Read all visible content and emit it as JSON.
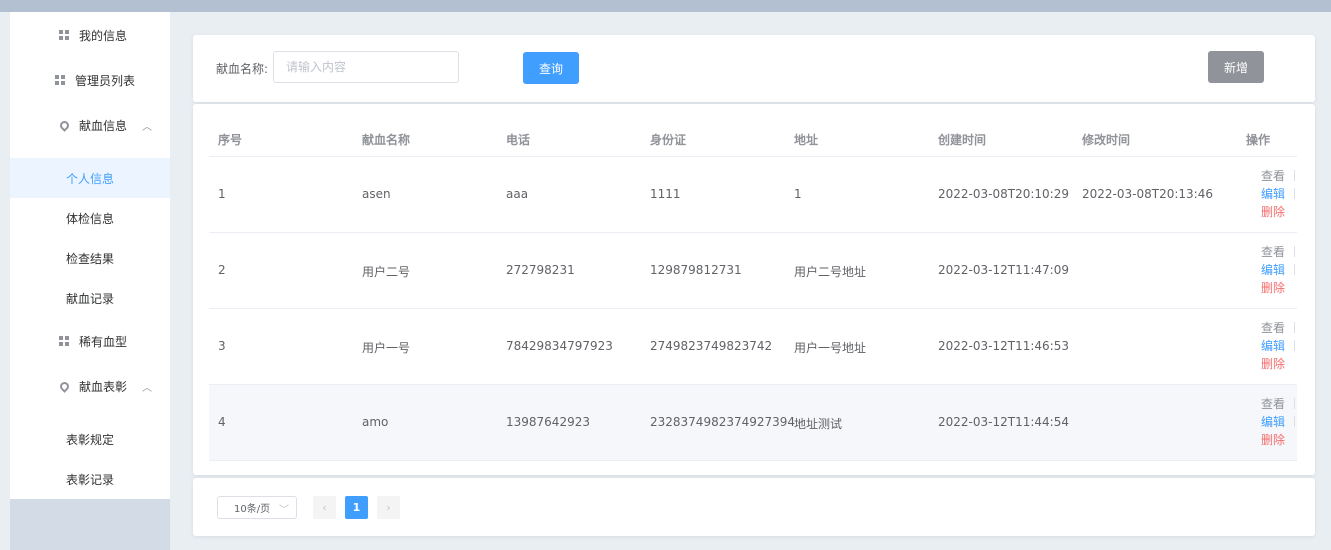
{
  "sidebar": {
    "items": [
      {
        "label": "我的信息",
        "icon": "grid-icon"
      },
      {
        "label": "管理员列表",
        "icon": "grid-icon"
      },
      {
        "label": "献血信息",
        "icon": "location-icon"
      },
      {
        "label": "个人信息"
      },
      {
        "label": "体检信息"
      },
      {
        "label": "检查结果"
      },
      {
        "label": "献血记录"
      },
      {
        "label": "稀有血型",
        "icon": "grid-icon"
      },
      {
        "label": "献血表彰",
        "icon": "location-icon"
      },
      {
        "label": "表彰规定"
      },
      {
        "label": "表彰记录"
      }
    ],
    "active_color": "#409eff"
  },
  "search": {
    "label": "献血名称:",
    "placeholder": "请输入内容",
    "query_label": "查询",
    "add_label": "新增"
  },
  "table": {
    "columns": [
      "序号",
      "献血名称",
      "电话",
      "身份证",
      "地址",
      "创建时间",
      "修改时间",
      "操作"
    ],
    "rows": [
      {
        "idx": "1",
        "name": "asen",
        "phone": "aaa",
        "idcard": "1111",
        "address": "1",
        "created": "2022-03-08T20:10:29",
        "modified": "2022-03-08T20:13:46"
      },
      {
        "idx": "2",
        "name": "用户二号",
        "phone": "272798231",
        "idcard": "129879812731",
        "address": "用户二号地址",
        "created": "2022-03-12T11:47:09",
        "modified": ""
      },
      {
        "idx": "3",
        "name": "用户一号",
        "phone": "78429834797923",
        "idcard": "2749823749823742",
        "address": "用户一号地址",
        "created": "2022-03-12T11:46:53",
        "modified": ""
      },
      {
        "idx": "4",
        "name": "amo",
        "phone": "13987642923",
        "idcard": "2328374982374927394",
        "address": "地址测试",
        "created": "2022-03-12T11:44:54",
        "modified": ""
      }
    ],
    "ops": {
      "view": "查看",
      "edit": "编辑",
      "delete": "删除"
    }
  },
  "pagination": {
    "page_size": "10条/页",
    "current_page": "1",
    "prev": "‹",
    "next": "›"
  },
  "colors": {
    "primary": "#409eff",
    "danger": "#f56c6c",
    "info": "#909399"
  }
}
